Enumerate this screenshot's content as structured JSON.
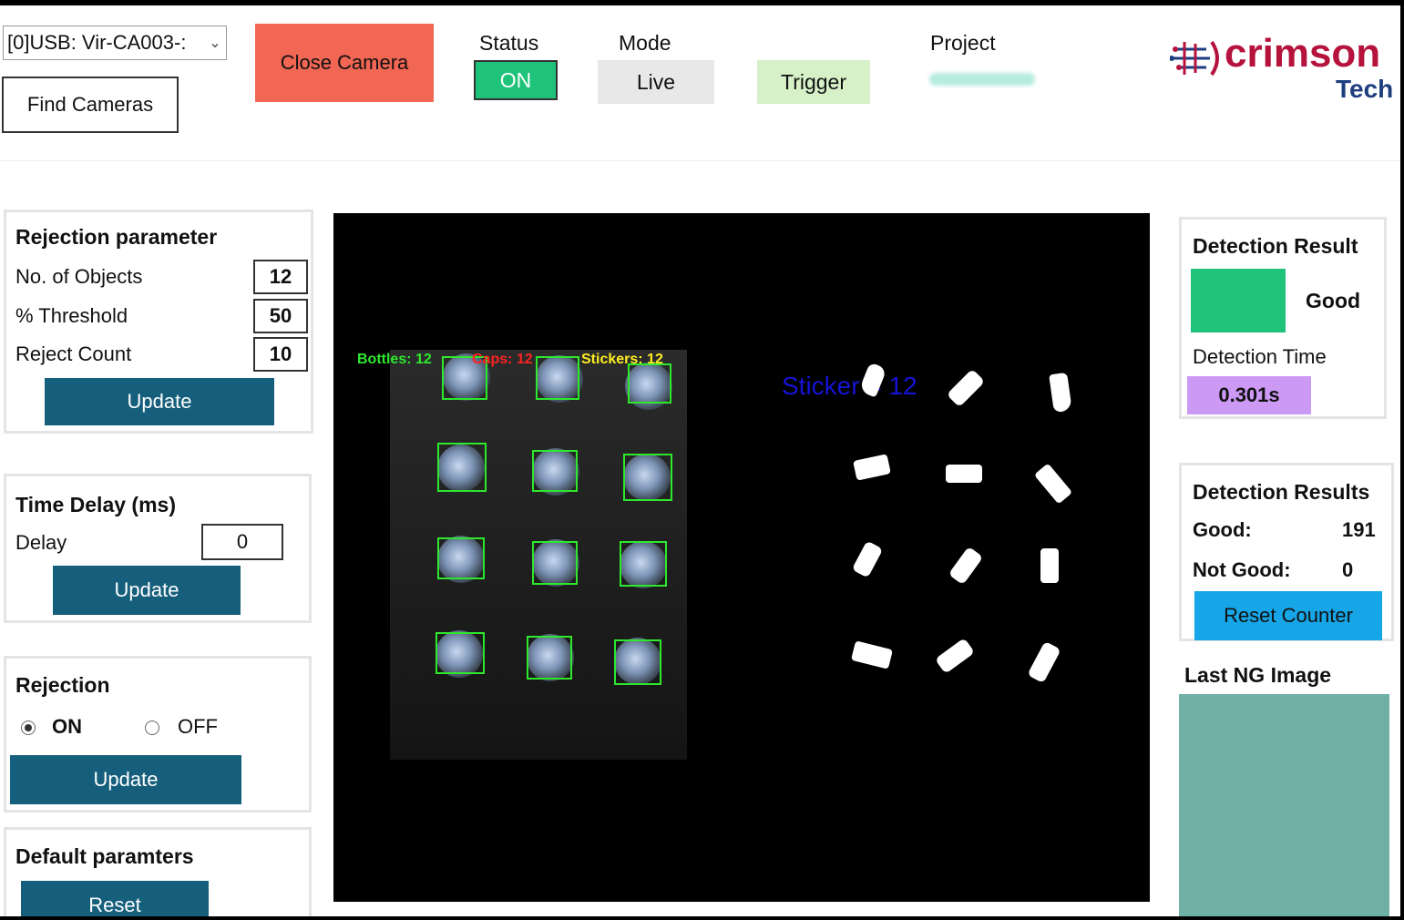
{
  "header": {
    "camera_select_value": "[0]USB: Vir-CA003-:",
    "find_cameras_label": "Find Cameras",
    "close_camera_label": "Close Camera",
    "status_label": "Status",
    "status_value": "ON",
    "mode_label": "Mode",
    "mode_live_label": "Live",
    "mode_trigger_label": "Trigger",
    "project_label": "Project",
    "logo_text": "crimson",
    "logo_subtext": "Tech"
  },
  "rejection_parameter": {
    "title": "Rejection parameter",
    "rows": [
      {
        "label": "No. of Objects",
        "value": "12"
      },
      {
        "label": "% Threshold",
        "value": "50"
      },
      {
        "label": "Reject Count",
        "value": "10"
      }
    ],
    "update_label": "Update"
  },
  "time_delay": {
    "title": "Time Delay (ms)",
    "delay_label": "Delay",
    "delay_value": "0",
    "update_label": "Update"
  },
  "rejection": {
    "title": "Rejection",
    "on_label": "ON",
    "off_label": "OFF",
    "selected": "ON",
    "update_label": "Update"
  },
  "default_parameters": {
    "title": "Default paramters",
    "reset_label": "Reset"
  },
  "camera_view": {
    "overlay_bottles": "Bottles: 12",
    "overlay_caps": "Caps: 12",
    "overlay_stickers": "Stickers: 12",
    "sticker_count_text": "Sticker = 12"
  },
  "detection_result": {
    "title": "Detection Result",
    "result_text": "Good",
    "time_label": "Detection Time",
    "time_value": "0.301s"
  },
  "detection_results": {
    "title": "Detection Results",
    "good_label": "Good:",
    "good_value": "191",
    "not_good_label": "Not Good:",
    "not_good_value": "0",
    "reset_counter_label": "Reset Counter"
  },
  "last_ng": {
    "title": "Last NG Image"
  },
  "colors": {
    "close_camera": "#f26654",
    "status_on": "#1fc27a",
    "primary_button": "#165f7c",
    "reset_counter": "#16a5e6",
    "detection_time": "#cc99f5",
    "ng_image": "#6fb0a6",
    "logo": "#b5123c"
  }
}
